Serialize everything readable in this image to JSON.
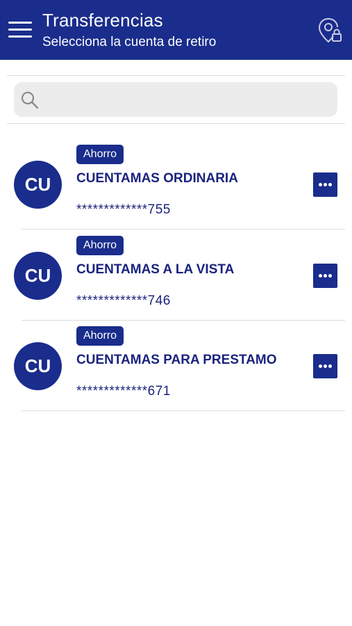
{
  "header": {
    "title": "Transferencias",
    "subtitle": "Selecciona la cuenta de retiro",
    "background_color": "#1a2d8c",
    "menu_icon": "hamburger-menu-icon",
    "right_icon": "location-lock-icon"
  },
  "search": {
    "placeholder": "",
    "value": "",
    "icon": "search-icon"
  },
  "accounts": [
    {
      "initials": "CU",
      "type": "Ahorro",
      "name": "CUENTAMAS ORDINARIA",
      "number": "*************755"
    },
    {
      "initials": "CU",
      "type": "Ahorro",
      "name": "CUENTAMAS A LA VISTA",
      "number": "*************746"
    },
    {
      "initials": "CU",
      "type": "Ahorro",
      "name": "CUENTAMAS PARA PRESTAMO",
      "number": "*************671"
    }
  ],
  "colors": {
    "brand": "#1a2d8c",
    "text": "#1a237e"
  }
}
